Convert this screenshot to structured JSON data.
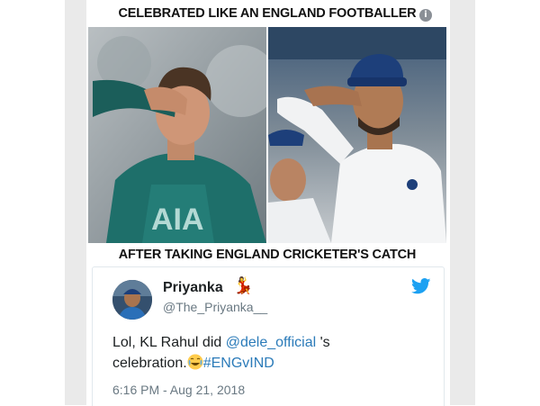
{
  "meme": {
    "top_caption": "CELEBRATED LIKE AN ENGLAND FOOTBALLER",
    "bottom_caption": "AFTER TAKING ENGLAND CRICKETER'S CATCH",
    "info_badge": "i",
    "left_photo_icon": "footballer-celebration-photo",
    "right_photo_icon": "cricketer-celebration-photo"
  },
  "tweet": {
    "display_name": "Priyanka",
    "name_emoji_icon": "dancer-icon",
    "handle": "@The_Priyanka__",
    "text_prefix": "Lol, KL Rahul did ",
    "mention": "@dele_official",
    "text_mid": " 's",
    "text_line2": "celebration.",
    "emoji_icon": "laughing-tears-emoji",
    "hashtag": "#ENGvIND",
    "timestamp": "6:16 PM - Aug 21, 2018"
  },
  "colors": {
    "link": "#2b7bb9",
    "twitter_blue": "#1da1f2",
    "text": "#1c2022",
    "muted": "#697882"
  }
}
